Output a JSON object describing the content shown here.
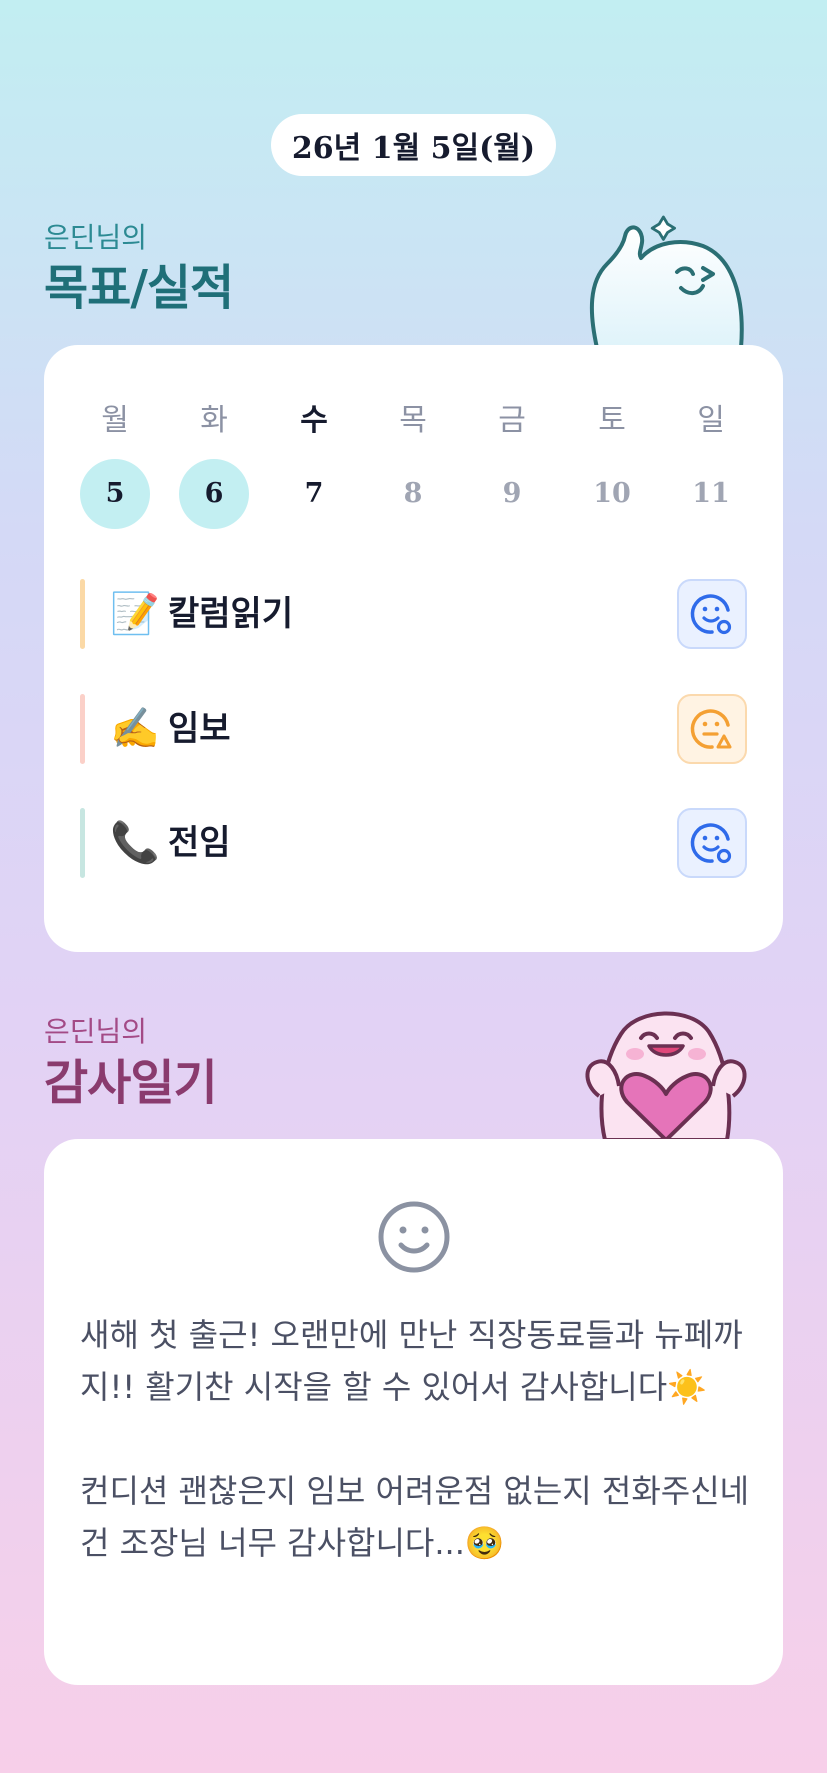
{
  "date_label": "26년 1월 5일(월)",
  "goals_section": {
    "owner": "은딘님의",
    "title": "목표/실적"
  },
  "week": {
    "days": [
      "월",
      "화",
      "수",
      "목",
      "금",
      "토",
      "일"
    ],
    "dates": [
      "5",
      "6",
      "7",
      "8",
      "9",
      "10",
      "11"
    ]
  },
  "goals": [
    {
      "emoji": "📝",
      "label": "칼럼읽기",
      "bar_color": "#fbd9a6",
      "status": "achieved-face-icon"
    },
    {
      "emoji": "✍️",
      "label": "임보",
      "bar_color": "#fbd0c8",
      "status": "partial-face-icon"
    },
    {
      "emoji": "📞",
      "label": "전임",
      "bar_color": "#c7e6e1",
      "status": "achieved-face-icon"
    }
  ],
  "gratitude_section": {
    "owner": "은딘님의",
    "title": "감사일기"
  },
  "diary": {
    "mood_icon": "smile-face-icon",
    "paragraphs": [
      "새해 첫 출근! 오랜만에 만난 직장동료들과 뉴페까지!! 활기찬 시작을 할 수 있어서 감사합니다☀️",
      "컨디션 괜찮은지 임보 어려운점 없는지 전화주신네건 조장님 너무 감사합니다...🥹"
    ]
  },
  "colors": {
    "done_circle": "#c3eff2",
    "achieved_icon": "#2f6bea",
    "partial_icon": "#f4a033",
    "goals_title": "#1f6f78",
    "gratitude_title": "#8a3b6e"
  }
}
